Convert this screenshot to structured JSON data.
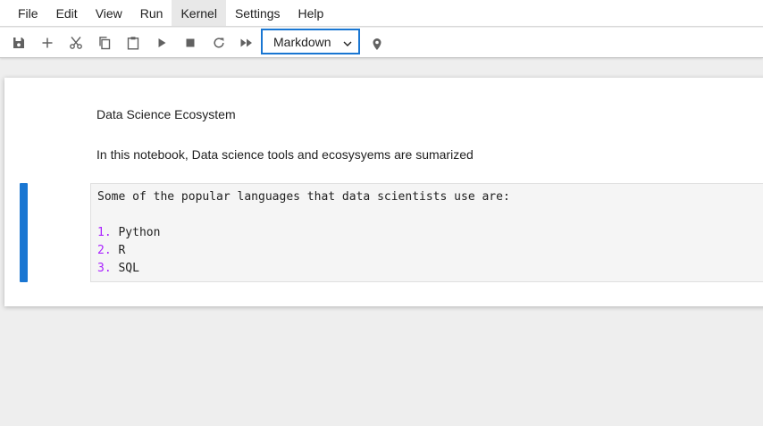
{
  "menubar": {
    "items": [
      {
        "label": "File"
      },
      {
        "label": "Edit"
      },
      {
        "label": "View"
      },
      {
        "label": "Run"
      },
      {
        "label": "Kernel"
      },
      {
        "label": "Settings"
      },
      {
        "label": "Help"
      }
    ]
  },
  "toolbar": {
    "cell_type": "Markdown",
    "buttons": [
      "save-icon",
      "plus-icon",
      "scissors-icon",
      "copy-icon",
      "paste-icon",
      "play-icon",
      "stop-icon",
      "restart-icon",
      "fast-forward-icon",
      "map-pin-icon"
    ]
  },
  "notebook": {
    "title": "Data Science Ecosystem",
    "paragraph": "In this notebook, Data science tools and ecosysyems are sumarized",
    "editor": {
      "intro": "Some of the popular languages that data scientists use are:",
      "items": [
        {
          "num": "1.",
          "text": "Python"
        },
        {
          "num": "2.",
          "text": "R"
        },
        {
          "num": "3.",
          "text": "SQL"
        }
      ]
    }
  },
  "colors": {
    "accent": "#1976d2",
    "list_number": "#aa22ff",
    "editor_bg": "#f5f5f5"
  }
}
